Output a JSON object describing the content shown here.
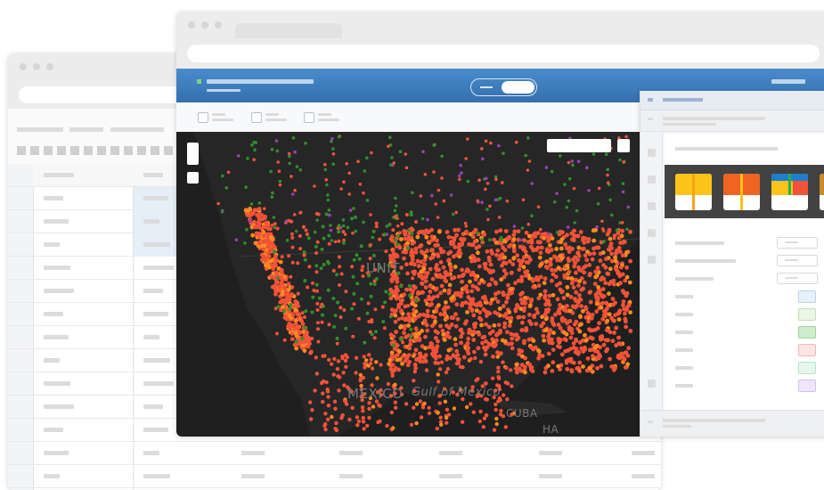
{
  "map": {
    "labels": {
      "country_usa": "UNIT",
      "country_mexico": "MEXICO",
      "water_gulf": "Gulf of Mexico",
      "country_cuba": "CUBA",
      "country_haiti": "HA"
    }
  },
  "colors": {
    "header_blue": "#3b7fc1",
    "map_background": "#1f1f1f",
    "point_primary": "#f25238",
    "point_secondary": "#ff8a1f",
    "point_tertiary": "#2f8f2a",
    "point_quaternary": "#9b3fb5",
    "swatch_yellow": "#fcc419",
    "swatch_orange": "#f06423",
    "swatch_blue": "#1c7fd0",
    "swatch_green": "#29b24a"
  },
  "icons": {
    "window_controls": "traffic-light-dots",
    "map_zoom": "plus-minus",
    "palette": "color-swatches"
  }
}
